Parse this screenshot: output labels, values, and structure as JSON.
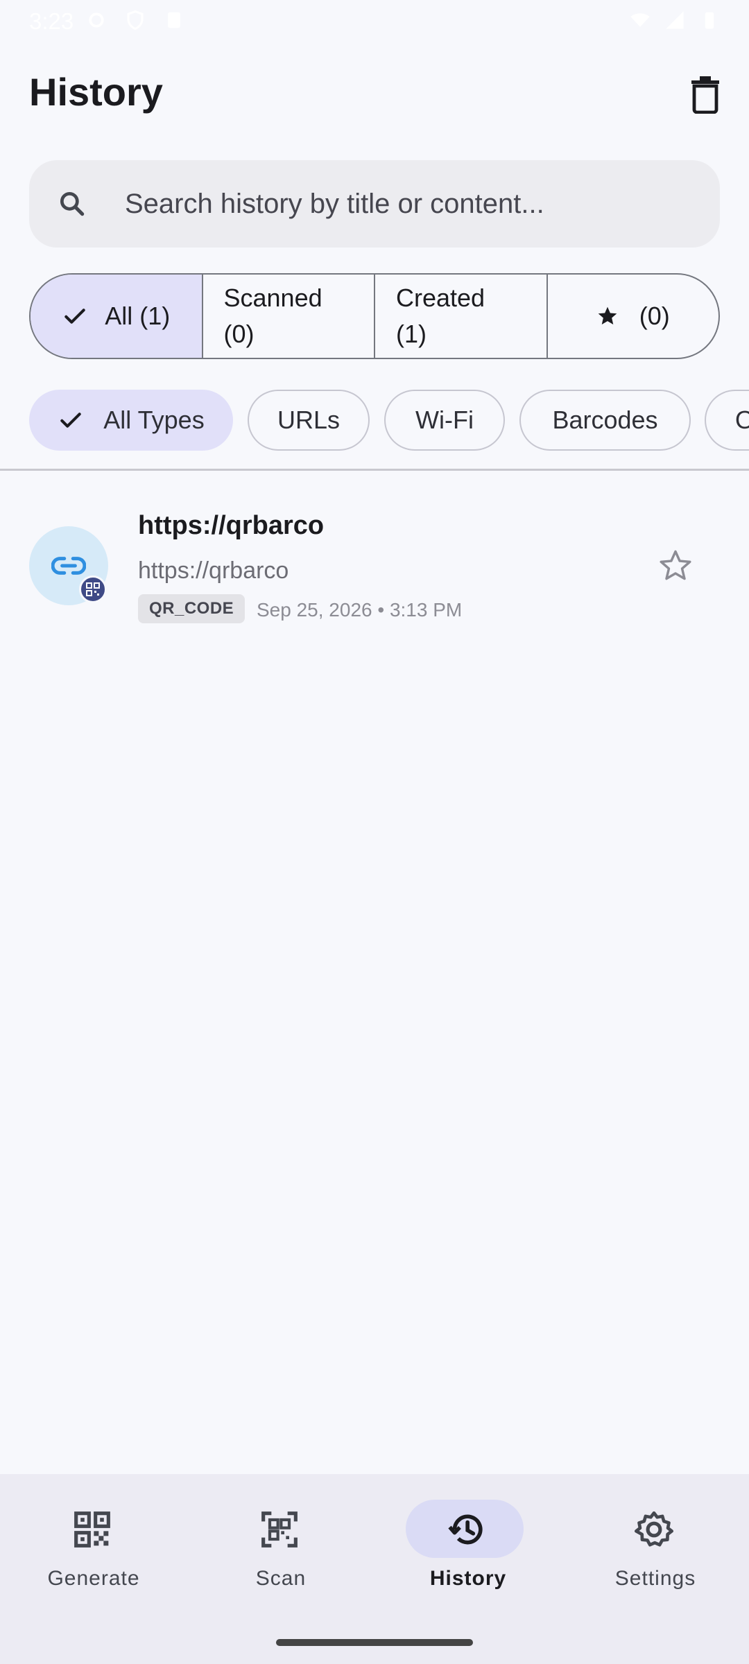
{
  "status": {
    "time": "3:23"
  },
  "header": {
    "title": "History",
    "delete_icon": "trash-icon"
  },
  "search": {
    "placeholder": "Search history by title or content..."
  },
  "segments": [
    {
      "label": "All (1)",
      "selected": true
    },
    {
      "label": "Scanned (0)",
      "line1": "Scanned",
      "line2": "(0)"
    },
    {
      "label": "Created (1)",
      "line1": "Created",
      "line2": "(1)"
    },
    {
      "label": "(0)",
      "icon": "star-icon"
    }
  ],
  "chips": [
    {
      "label": "All Types",
      "selected": true
    },
    {
      "label": "URLs"
    },
    {
      "label": "Wi-Fi"
    },
    {
      "label": "Barcodes"
    },
    {
      "label": "O"
    }
  ],
  "items": [
    {
      "title": "https://qrbarco",
      "subtitle": "https://qrbarco",
      "type": "QR_CODE",
      "date": "Sep 25, 2026 • 3:13 PM",
      "favorite": false
    }
  ],
  "nav": [
    {
      "label": "Generate",
      "icon": "qr-code-icon"
    },
    {
      "label": "Scan",
      "icon": "qr-scan-icon"
    },
    {
      "label": "History",
      "icon": "history-icon",
      "selected": true
    },
    {
      "label": "Settings",
      "icon": "gear-icon"
    }
  ],
  "colors": {
    "accent": "#e1e0f9",
    "nav_active": "#dadbf5",
    "link_avatar": "#d6eaf8",
    "badge": "#3f4a86"
  }
}
